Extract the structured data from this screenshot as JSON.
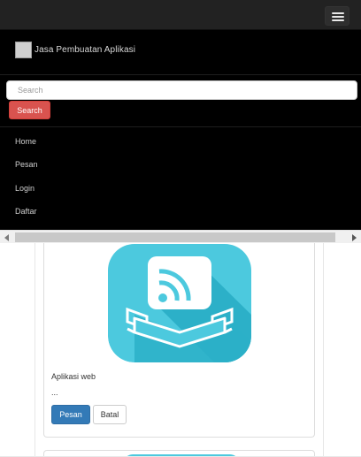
{
  "header": {
    "menu_toggle_icon": "hamburger-icon"
  },
  "nav": {
    "brand_icon": "app-logo-icon",
    "brand_text": "Jasa Pembuatan Aplikasi",
    "search": {
      "placeholder": "Search",
      "button_label": "Search"
    },
    "items": [
      {
        "label": "Home"
      },
      {
        "label": "Pesan"
      },
      {
        "label": "Login"
      },
      {
        "label": "Daftar"
      }
    ]
  },
  "scrollbar": {
    "left_icon": "scroll-left-icon",
    "right_icon": "scroll-right-icon"
  },
  "product": {
    "icon": "rss-feed-ribbon-icon",
    "title": "Aplikasi web",
    "description": "...",
    "order_label": "Pesan",
    "cancel_label": "Batal"
  },
  "colors": {
    "topbar": "#222222",
    "nav_background": "#000000",
    "search_button": "#d9534f",
    "primary_button": "#337ab7",
    "icon_cyan": "#4cc9de",
    "icon_dark_cyan": "#2cb0c8"
  }
}
